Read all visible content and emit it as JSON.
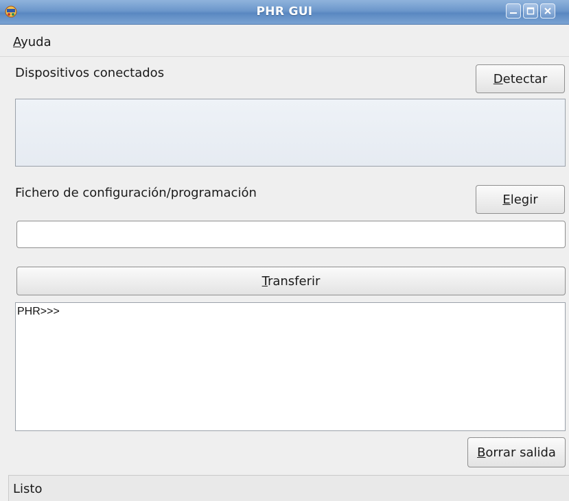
{
  "window": {
    "title": "PHR GUI"
  },
  "menu": {
    "ayuda_first": "A",
    "ayuda_rest": "yuda"
  },
  "devices": {
    "label": "Dispositivos conectados",
    "detect_first": "D",
    "detect_rest": "etectar"
  },
  "config": {
    "label": "Fichero de configuración/programación",
    "choose_first": "E",
    "choose_rest": "legir",
    "file_value": ""
  },
  "transfer": {
    "first": "T",
    "rest": "ransferir"
  },
  "output": {
    "text": "PHR>>>",
    "clear_first": "B",
    "clear_rest": "orrar salida"
  },
  "status": {
    "text": "Listo"
  },
  "icons": {
    "app": "app-icon",
    "minimize": "minimize-icon",
    "maximize": "maximize-icon",
    "close": "close-icon"
  }
}
